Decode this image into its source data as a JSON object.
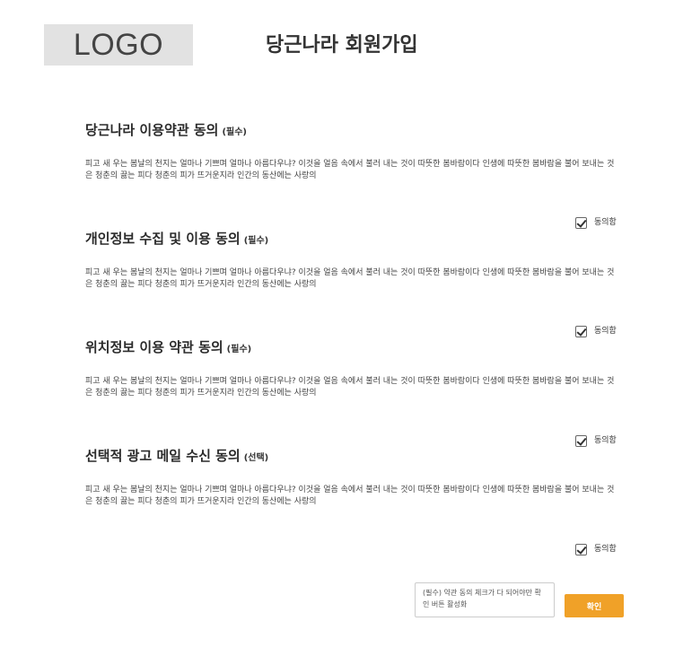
{
  "header": {
    "logo_text": "LOGO",
    "title": "당근나라 회원가입"
  },
  "sections": [
    {
      "title": "당근나라 이용약관 동의",
      "tag": "(필수)",
      "body": "피고 새 우는 봄날의 천지는 얼마나 기쁘며 얼마나 아름다우냐? 이것을 얼음 속에서 불러 내는 것이 따뜻한 봄바람이다 인생에 따뜻한 봄바람을 불어 보내는 것은 청춘의 끓는 피다 청춘의 피가 뜨거운지라 인간의 동산에는 사랑의",
      "agree_label": "동의함",
      "checked": true
    },
    {
      "title": "개인정보 수집 및 이용 동의",
      "tag": "(필수)",
      "body": "피고 새 우는 봄날의 천지는 얼마나 기쁘며 얼마나 아름다우냐? 이것을 얼음 속에서 불러 내는 것이 따뜻한 봄바람이다 인생에 따뜻한 봄바람을 불어 보내는 것은 청춘의 끓는 피다 청춘의 피가 뜨거운지라 인간의 동산에는 사랑의",
      "agree_label": "동의함",
      "checked": true
    },
    {
      "title": "위치정보 이용 약관 동의",
      "tag": "(필수)",
      "body": "피고 새 우는 봄날의 천지는 얼마나 기쁘며 얼마나 아름다우냐? 이것을 얼음 속에서 불러 내는 것이 따뜻한 봄바람이다 인생에 따뜻한 봄바람을 불어 보내는 것은 청춘의 끓는 피다 청춘의 피가 뜨거운지라 인간의 동산에는 사랑의",
      "agree_label": "동의함",
      "checked": true
    },
    {
      "title": "선택적 광고 메일 수신 동의",
      "tag": "(선택)",
      "body": "피고 새 우는 봄날의 천지는 얼마나 기쁘며 얼마나 아름다우냐? 이것을 얼음 속에서 불러 내는 것이 따뜻한 봄바람이다 인생에 따뜻한 봄바람을 불어 보내는 것은 청춘의 끓는 피다 청춘의 피가 뜨거운지라 인간의 동산에는 사랑의",
      "agree_label": "동의함",
      "checked": true
    }
  ],
  "footer": {
    "notice": "(필수) 약관 동의 체크가 다 되어야만 확인 버튼 활성화",
    "confirm_label": "확인"
  },
  "colors": {
    "accent": "#f0a128",
    "logo_bg": "#e2e2e2"
  }
}
